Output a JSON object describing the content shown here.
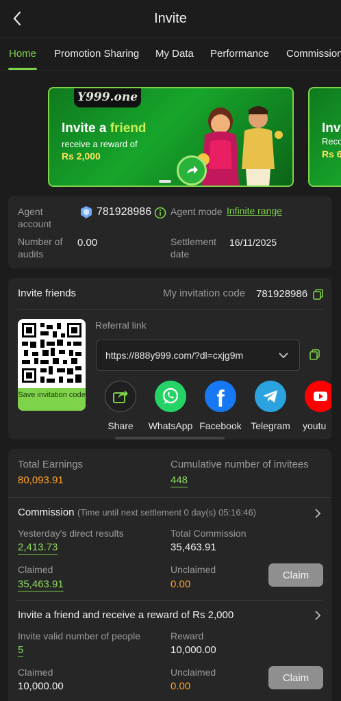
{
  "header": {
    "title": "Invite"
  },
  "tabs": [
    {
      "label": "Home"
    },
    {
      "label": "Promotion Sharing"
    },
    {
      "label": "My Data"
    },
    {
      "label": "Performance"
    },
    {
      "label": "Commission"
    }
  ],
  "banner": {
    "logo": "Y999.one",
    "line1_a": "Invite a ",
    "line1_b": "friend",
    "line2": "receive a reward of",
    "line3": "Rs 2,000"
  },
  "banner2": {
    "line1": "Inv",
    "line2": "Reco",
    "line3": "Rs 6"
  },
  "agent": {
    "account_label": "Agent account",
    "account_value": "781928986",
    "mode_label": "Agent mode",
    "mode_value": "Infinite range",
    "audits_label": "Number of audits",
    "audits_value": "0.00",
    "settlement_label": "Settlement date",
    "settlement_value": "16/11/2025"
  },
  "invite": {
    "title": "Invite friends",
    "code_label": "My invitation code",
    "code_value": "781928986",
    "referral_label": "Referral link",
    "referral_value": "https://888y999.com/?dl=cxjg9m",
    "qr_save_label": "Save invitation code",
    "share_targets": [
      {
        "label": "Share",
        "icon": "share-icon"
      },
      {
        "label": "WhatsApp",
        "icon": "whatsapp-icon"
      },
      {
        "label": "Facebook",
        "icon": "facebook-icon"
      },
      {
        "label": "Telegram",
        "icon": "telegram-icon"
      },
      {
        "label": "youtu",
        "icon": "youtube-icon"
      }
    ]
  },
  "earnings": {
    "total_label": "Total Earnings",
    "total_value": "80,093.91",
    "invitees_label": "Cumulative number of invitees",
    "invitees_value": "448"
  },
  "commission": {
    "title": "Commission",
    "subtitle": "(Time until next settlement 0 day(s) 05:16:46)",
    "yesterday_label": "Yesterday's direct results",
    "yesterday_value": "2,413.73",
    "total_label": "Total Commission",
    "total_value": "35,463.91",
    "claimed_label": "Claimed",
    "claimed_value": "35,463.91",
    "unclaimed_label": "Unclaimed",
    "unclaimed_value": "0.00",
    "claim_button": "Claim"
  },
  "reward": {
    "title": "Invite a friend and receive a reward of Rs 2,000",
    "valid_label": "Invite valid number of people",
    "valid_value": "5",
    "reward_label": "Reward",
    "reward_value": "10,000.00",
    "claimed_label": "Claimed",
    "claimed_value": "10,000.00",
    "unclaimed_label": "Unclaimed",
    "unclaimed_value": "0.00",
    "claim_button": "Claim"
  },
  "colors": {
    "accent": "#7ed34b",
    "bg": "#1c1c1c",
    "card": "#262626",
    "orange": "#ff9f2a"
  }
}
